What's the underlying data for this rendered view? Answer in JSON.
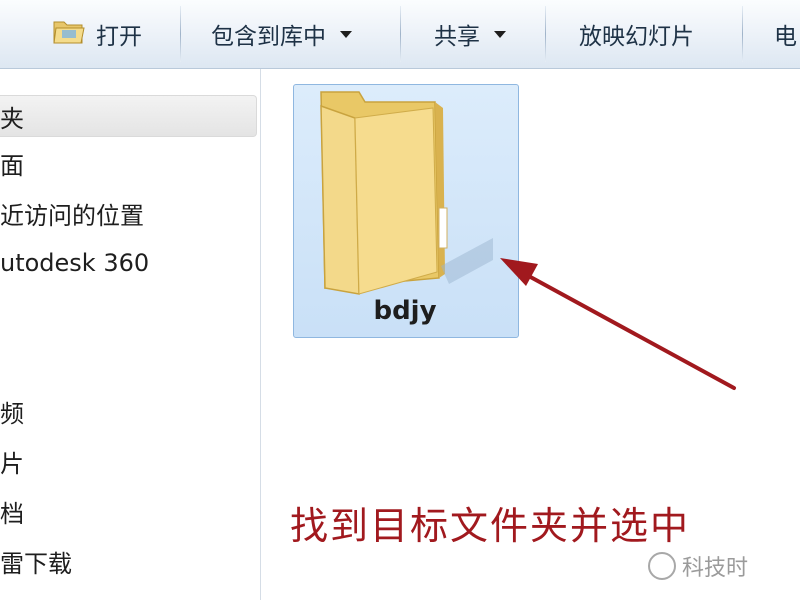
{
  "toolbar": {
    "open_label": "打开",
    "include_in_library_label": "包含到库中",
    "share_label": "共享",
    "slideshow_label": "放映幻灯片",
    "cut_off_label": "电"
  },
  "nav": {
    "items": [
      {
        "label": "夹夹"
      },
      {
        "label": "面"
      },
      {
        "label": "近访问的位置"
      },
      {
        "label": "utodesk 360"
      },
      {
        "label": "频"
      },
      {
        "label": "片"
      },
      {
        "label": "档"
      },
      {
        "label": "雷下载"
      }
    ]
  },
  "content": {
    "folder_name": "bdjy"
  },
  "annotation": {
    "text": "找到目标文件夹并选中",
    "color": "#a1191e"
  },
  "watermark": {
    "text": "科技时"
  }
}
